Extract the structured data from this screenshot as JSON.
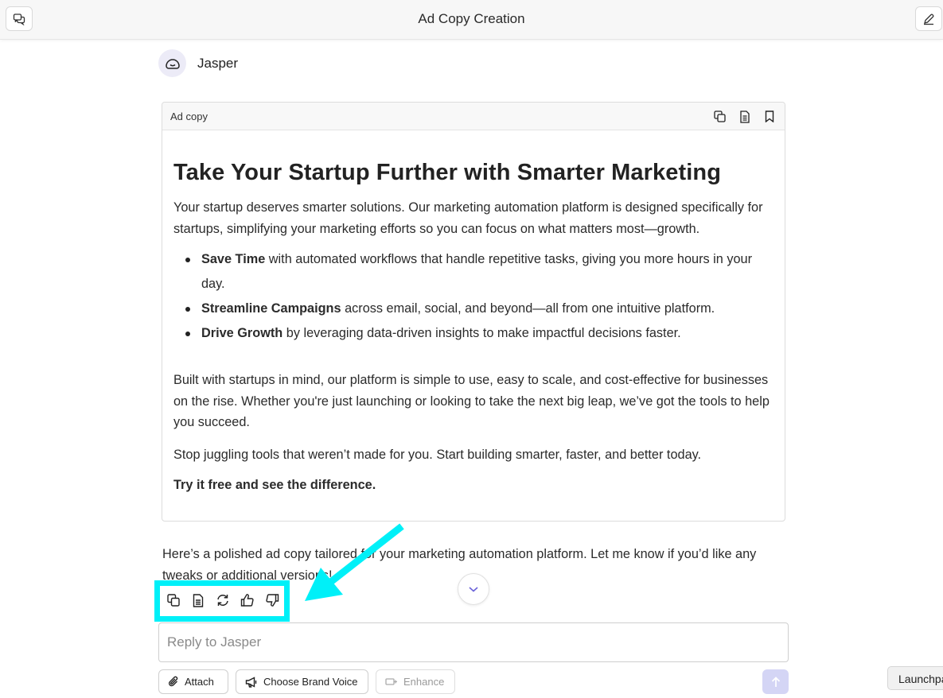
{
  "header": {
    "title": "Ad Copy Creation",
    "left_icon": "chat-bubbles-icon",
    "right_icon": "edit-pencil-icon"
  },
  "sender": {
    "name": "Jasper",
    "avatar_icon": "jasper-logo-icon"
  },
  "card": {
    "label": "Ad copy",
    "icons": [
      "copy-icon",
      "document-icon",
      "bookmark-icon"
    ],
    "headline": "Take Your Startup Further with Smarter Marketing",
    "intro": "Your startup deserves smarter solutions. Our marketing automation platform is designed specifically for startups, simplifying your marketing efforts so you can focus on what matters most—growth.",
    "bullets": [
      {
        "bold": "Save Time",
        "text": " with automated workflows that handle repetitive tasks, giving you more hours in your day."
      },
      {
        "bold": "Streamline Campaigns",
        "text": " across email, social, and beyond—all from one intuitive platform."
      },
      {
        "bold": "Drive Growth",
        "text": " by leveraging data-driven insights to make impactful decisions faster."
      }
    ],
    "body": "Built with startups in mind, our platform is simple to use, easy to scale, and cost-effective for businesses on the rise. Whether you're just launching or looking to take the next big leap, we’ve got the tools to help you succeed.",
    "cta_line": "Stop juggling tools that weren’t made for you. Start building smarter, faster, and better today.",
    "closer": "Try it free and see the difference."
  },
  "reply_text": "Here’s a polished ad copy tailored for your marketing automation platform. Let me know if you’d like any tweaks or additional versions!",
  "message_actions": [
    "copy-icon",
    "document-icon",
    "regenerate-icon",
    "thumbs-up-icon",
    "thumbs-down-icon"
  ],
  "annotation_color": "#00f0f8",
  "input": {
    "placeholder": "Reply to Jasper",
    "value": ""
  },
  "tools": {
    "attach": "Attach",
    "brand_voice": "Choose Brand Voice",
    "enhance": "Enhance"
  },
  "send_color": "#d4d5f5",
  "launchpad": "Launchpad"
}
